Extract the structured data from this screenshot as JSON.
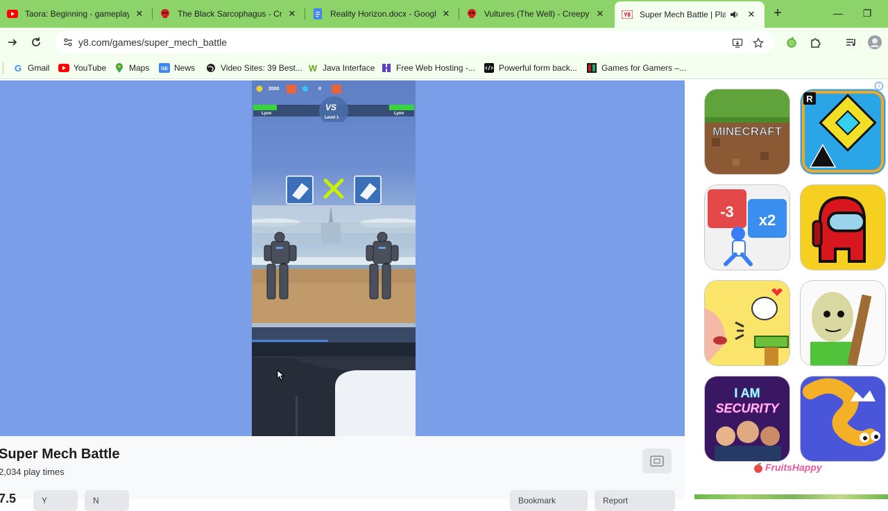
{
  "tabs": [
    {
      "title": "Taora: Beginning - gameplay I",
      "favicon": "youtube-icon"
    },
    {
      "title": "The Black Sarcophagus - Cree",
      "favicon": "red-skull-icon"
    },
    {
      "title": "Reality Horizon.docx - Google",
      "favicon": "google-docs-icon"
    },
    {
      "title": "Vultures (The Well) - Creepyp",
      "favicon": "red-skull-icon"
    },
    {
      "title": "Super Mech Battle | Play N",
      "favicon": "y8-icon",
      "active": true
    }
  ],
  "address_bar": {
    "url": "y8.com/games/super_mech_battle"
  },
  "bookmarks": [
    {
      "label": "Gmail",
      "icon": "google-icon"
    },
    {
      "label": "YouTube",
      "icon": "youtube-icon"
    },
    {
      "label": "Maps",
      "icon": "maps-icon"
    },
    {
      "label": "News",
      "icon": "news-icon"
    },
    {
      "label": "Video Sites: 39 Best...",
      "icon": "globe-icon"
    },
    {
      "label": "Java Interface",
      "icon": "w-icon"
    },
    {
      "label": "Free Web Hosting -...",
      "icon": "hosting-icon"
    },
    {
      "label": "Powerful form back...",
      "icon": "code-icon"
    },
    {
      "label": "Games for Gamers –...",
      "icon": "games-icon"
    }
  ],
  "game": {
    "hud": {
      "coins": "2000",
      "gems": "0",
      "vs": "VS",
      "level": "Level 1",
      "left_name": "Lyon",
      "right_name": "Lyon"
    }
  },
  "info": {
    "title": "Super Mech Battle",
    "play_times": "2,034 play times",
    "rating": "7.5",
    "like_label": "Y",
    "dislike_label": "N",
    "bookmark_label": "Bookmark",
    "report_label": "Report"
  },
  "ads": {
    "tiles": [
      "MINECRAFT",
      "Geometry Dash Lite",
      "-3 x2",
      "Among Us",
      "Chicken",
      "Baldi",
      "I AM SECURITY",
      "Snake"
    ],
    "sponsor": "FruitsHappy"
  }
}
